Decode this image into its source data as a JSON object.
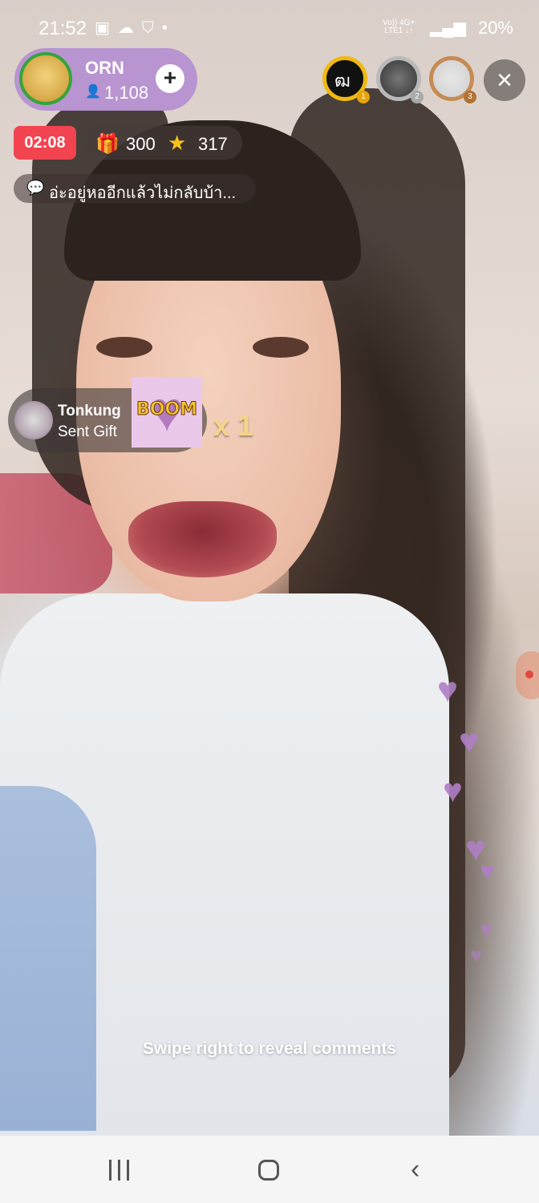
{
  "status_bar": {
    "time": "21:52",
    "left_icons": "▣☁⛉•",
    "network": "Vo)) 4G+\nLTE1 ↓↑",
    "battery": "20%"
  },
  "host": {
    "name": "ORN",
    "viewers": "1,108",
    "avatar_icon": "avatar",
    "follow_icon": "plus-circle-icon"
  },
  "top_viewers": [
    {
      "rank": "1",
      "label": "ฒ"
    },
    {
      "rank": "2",
      "label": ""
    },
    {
      "rank": "3",
      "label": ""
    }
  ],
  "close_icon": "×",
  "timer": "02:08",
  "stats": {
    "gifts": "300",
    "stars": "317"
  },
  "comment_preview": "อ่ะอยู่หออีกแล้วไม่กลับบ้า...",
  "gift_banner": {
    "sender": "Tonkung",
    "action": "Sent Gift",
    "gift_name": "BOOM",
    "multiplier": "x 1"
  },
  "hint": "Swipe right to reveal comments",
  "colors": {
    "timer_bg": "#f24450",
    "host_pill": "#b894d1",
    "heart": "#b07fc5"
  }
}
